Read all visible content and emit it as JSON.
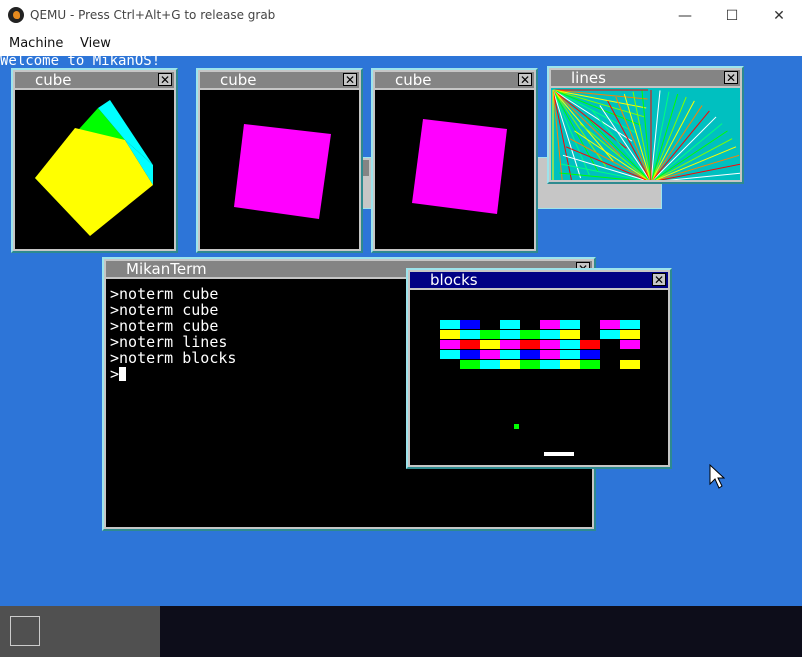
{
  "host": {
    "title": "QEMU - Press Ctrl+Alt+G to release grab",
    "controls": {
      "minimize": "—",
      "maximize": "☐",
      "close": "✕"
    },
    "menu": [
      "Machine",
      "View"
    ]
  },
  "guest": {
    "welcome": "Welcome to MikanOS!",
    "background_color": "#2d75d8",
    "windows": {
      "cube1": {
        "title": "cube"
      },
      "cube2": {
        "title": "cube"
      },
      "cube3": {
        "title": "cube"
      },
      "lines": {
        "title": "lines"
      },
      "terminal": {
        "title": "MikanTerm",
        "lines": [
          ">noterm cube",
          ">noterm cube",
          ">noterm cube",
          ">noterm lines",
          ">noterm blocks",
          ">"
        ]
      },
      "blocks": {
        "title": "blocks"
      }
    },
    "close_glyph": "✕"
  },
  "colors": {
    "window_border_light": "#9de4ec",
    "window_border_dark": "#2e8a8f",
    "title_inactive": "#848484",
    "title_active": "#000084",
    "taskbar": "#0d0d1a",
    "taskbar_left": "#505050"
  },
  "blocks_game": {
    "rows": [
      [
        "cyan",
        "blue",
        "black",
        "cyan",
        "black",
        "magenta",
        "cyan",
        "black",
        "magenta",
        "cyan"
      ],
      [
        "yellow",
        "cyan",
        "green",
        "cyan",
        "green",
        "cyan",
        "yellow",
        "black",
        "cyan",
        "yellow"
      ],
      [
        "magenta",
        "red",
        "yellow",
        "magenta",
        "red",
        "magenta",
        "cyan",
        "red",
        "black",
        "magenta"
      ],
      [
        "cyan",
        "blue",
        "magenta",
        "cyan",
        "blue",
        "magenta",
        "cyan",
        "blue",
        "black",
        "black"
      ],
      [
        "black",
        "green",
        "cyan",
        "yellow",
        "green",
        "cyan",
        "yellow",
        "green",
        "black",
        "yellow"
      ]
    ]
  }
}
